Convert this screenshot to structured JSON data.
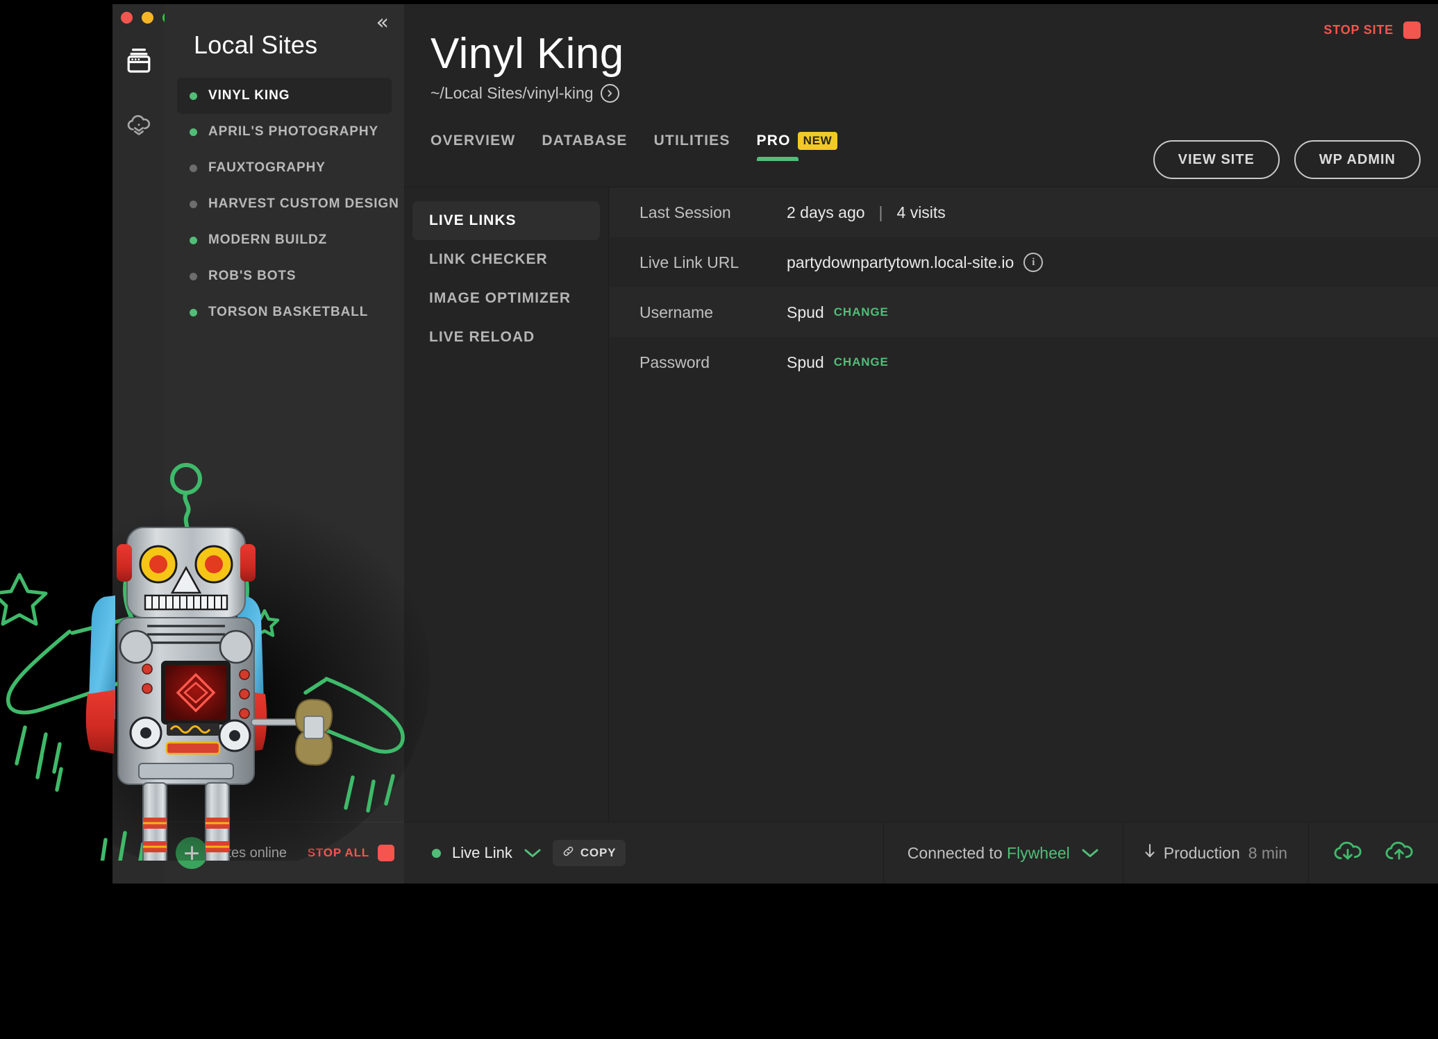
{
  "window": {
    "traffic_lights": [
      "close",
      "minimize",
      "zoom"
    ],
    "rail": [
      {
        "name": "sites",
        "icon": "sites-stack-icon",
        "active": true
      },
      {
        "name": "cloud",
        "icon": "cloud-download-icon",
        "active": false
      }
    ]
  },
  "sidebar": {
    "title": "Local Sites",
    "collapse_icon": "chevron-double-left-icon",
    "sites": [
      {
        "name": "VINYL KING",
        "status": "online",
        "active": true
      },
      {
        "name": "APRIL'S PHOTOGRAPHY",
        "status": "online",
        "active": false
      },
      {
        "name": "FAUXTOGRAPHY",
        "status": "offline",
        "active": false
      },
      {
        "name": "HARVEST CUSTOM DESIGN",
        "status": "offline",
        "active": false
      },
      {
        "name": "MODERN BUILDZ",
        "status": "online",
        "active": false
      },
      {
        "name": "ROB'S BOTS",
        "status": "offline",
        "active": false
      },
      {
        "name": "TORSON BASKETBALL",
        "status": "online",
        "active": false
      }
    ],
    "footer": {
      "add_site_icon": "plus-icon",
      "sites_online_label": "sites online",
      "stop_all_label": "STOP ALL",
      "stop_all_icon": "stop-square-icon"
    }
  },
  "header": {
    "stop_site_label": "STOP SITE",
    "stop_site_icon": "stop-square-icon",
    "site_title": "Vinyl King",
    "site_path": "~/Local Sites/vinyl-king",
    "path_open_icon": "circle-arrow-right-icon",
    "tabs": [
      {
        "label": "OVERVIEW",
        "active": false,
        "badge": null
      },
      {
        "label": "DATABASE",
        "active": false,
        "badge": null
      },
      {
        "label": "UTILITIES",
        "active": false,
        "badge": null
      },
      {
        "label": "PRO",
        "active": true,
        "badge": "NEW"
      }
    ],
    "actions": [
      {
        "label": "VIEW SITE"
      },
      {
        "label": "WP ADMIN"
      }
    ]
  },
  "subnav": [
    {
      "label": "LIVE LINKS",
      "active": true
    },
    {
      "label": "LINK CHECKER",
      "active": false
    },
    {
      "label": "IMAGE OPTIMIZER",
      "active": false
    },
    {
      "label": "LIVE RELOAD",
      "active": false
    }
  ],
  "detail": {
    "rows": [
      {
        "label": "Last Session",
        "value": "2 days ago",
        "separator": "|",
        "extra": "4 visits",
        "action": null,
        "icon": null
      },
      {
        "label": "Live  Link URL",
        "value": "partydownpartytown.local-site.io",
        "separator": null,
        "extra": null,
        "action": null,
        "icon": "info-icon"
      },
      {
        "label": "Username",
        "value": "Spud",
        "separator": null,
        "extra": null,
        "action": "CHANGE",
        "icon": null
      },
      {
        "label": "Password",
        "value": "Spud",
        "separator": null,
        "extra": null,
        "action": "CHANGE",
        "icon": null
      }
    ]
  },
  "bottombar": {
    "live_link_label": "Live Link",
    "live_link_status": "online",
    "live_link_chevron_icon": "chevron-down-icon",
    "copy_label": "COPY",
    "copy_icon": "link-icon",
    "connected_prefix": "Connected to",
    "connected_target": "Flywheel",
    "connected_chevron_icon": "chevron-down-icon",
    "push_pull_icon": "arrow-down-icon",
    "environment": "Production",
    "environment_age": "8 min",
    "pull_icon": "cloud-download-icon",
    "push_icon": "cloud-upload-icon"
  },
  "colors": {
    "accent_green": "#51be78",
    "danger_red": "#f4554f",
    "badge_yellow": "#f2c927",
    "window_bg": "#242424",
    "sidebar_bg": "#2d2d2d",
    "rail_bg": "#2b2b2b"
  },
  "mascot": {
    "name": "retro-tin-robot-illustration",
    "decorative": true
  }
}
